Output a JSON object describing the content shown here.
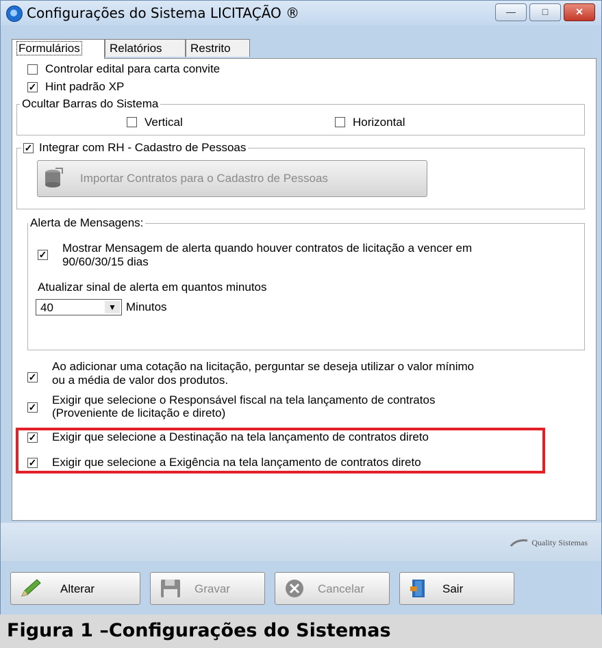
{
  "window": {
    "title": "Configurações do Sistema LICITAÇÃO ®",
    "minimize": "—",
    "maximize": "□",
    "close": "✕"
  },
  "tabs": [
    {
      "label": "Formulários",
      "active": true
    },
    {
      "label": "Relatórios"
    },
    {
      "label": "Restrito"
    }
  ],
  "options": {
    "edital": {
      "label": "Controlar edital para carta convite",
      "checked": false
    },
    "hint": {
      "label": "Hint padrão XP",
      "checked": true
    }
  },
  "barras": {
    "legend": "Ocultar Barras do Sistema",
    "vertical": {
      "label": "Vertical",
      "checked": false
    },
    "horizontal": {
      "label": "Horizontal",
      "checked": false
    }
  },
  "rh": {
    "label": "Integrar com RH - Cadastro de Pessoas",
    "checked": true,
    "import_button": "Importar Contratos para o Cadastro de Pessoas"
  },
  "alerta": {
    "legend": "Alerta de Mensagens:",
    "mostrar": {
      "line1": "Mostrar Mensagem de alerta quando houver contratos de licitação a vencer em",
      "line2": "90/60/30/15 dias",
      "checked": true
    },
    "atualizar_label": "Atualizar sinal de alerta em  quantos minutos",
    "minutes_value": "40",
    "minutes_unit": "Minutos"
  },
  "cotacao": {
    "line1": "Ao adicionar uma cotação na licitação, perguntar se deseja utilizar o valor mínimo",
    "line2": "ou a média de valor dos produtos.",
    "checked": true
  },
  "responsavel": {
    "line1": "Exigir que selecione o Responsável fiscal na tela lançamento de contratos",
    "line2": "(Proveniente de licitação e direto)",
    "checked": true
  },
  "destinacao": {
    "label": "Exigir que selecione a Destinação na tela lançamento de contratos direto",
    "checked": true
  },
  "exigencia": {
    "label": "Exigir que selecione a Exigência na tela lançamento de contratos direto",
    "checked": true
  },
  "brand": "Quality Sistemas",
  "buttons": {
    "alterar": "Alterar",
    "gravar": "Gravar",
    "cancelar": "Cancelar",
    "sair": "Sair"
  },
  "caption": "Figura 1 –Configurações do Sistemas",
  "colors": {
    "highlight": "#e32027",
    "window_frame": "#bcd3ea"
  }
}
